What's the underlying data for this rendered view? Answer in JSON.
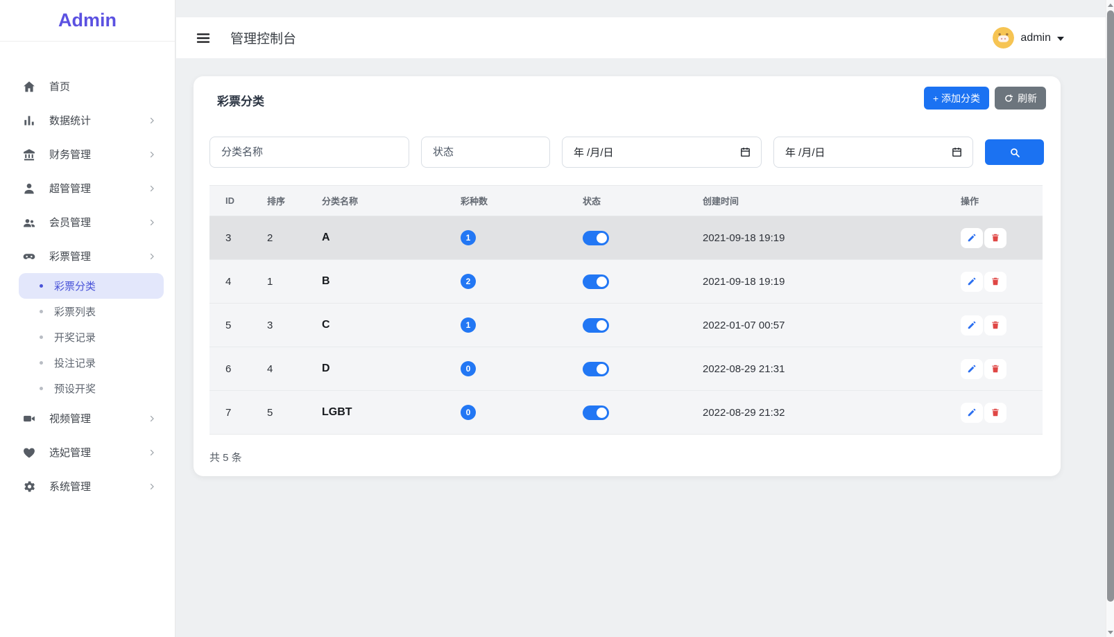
{
  "colors": {
    "accent_blue": "#1b72f2",
    "toggle_blue": "#2277f4",
    "badge_blue": "#2277f4",
    "refresh_gray": "#6c757d",
    "logo_purple": "#5b51e1",
    "active_item_blue": "#4953d8",
    "danger_red": "#df4745",
    "avatar_yellow": "#f6c453"
  },
  "sidebar": {
    "logo": "Admin",
    "items": [
      {
        "label": "首页",
        "icon": "home-icon",
        "expandable": false
      },
      {
        "label": "数据统计",
        "icon": "bar-chart-icon",
        "expandable": true
      },
      {
        "label": "财务管理",
        "icon": "bank-icon",
        "expandable": true
      },
      {
        "label": "超管管理",
        "icon": "user-icon",
        "expandable": true
      },
      {
        "label": "会员管理",
        "icon": "users-icon",
        "expandable": true
      },
      {
        "label": "彩票管理",
        "icon": "gamepad-icon",
        "expandable": true,
        "children": [
          {
            "label": "彩票分类",
            "active": true
          },
          {
            "label": "彩票列表",
            "active": false
          },
          {
            "label": "开奖记录",
            "active": false
          },
          {
            "label": "投注记录",
            "active": false
          },
          {
            "label": "预设开奖",
            "active": false
          }
        ]
      },
      {
        "label": "视频管理",
        "icon": "video-icon",
        "expandable": true
      },
      {
        "label": "选妃管理",
        "icon": "heart-icon",
        "expandable": true
      },
      {
        "label": "系统管理",
        "icon": "gear-icon",
        "expandable": true
      }
    ]
  },
  "topbar": {
    "title": "管理控制台",
    "username": "admin",
    "avatar": "pig-avatar-icon"
  },
  "card": {
    "title": "彩票分类",
    "add_button_label": "+ 添加分类",
    "refresh_button_label": "刷新",
    "filters": {
      "name_placeholder": "分类名称",
      "status_placeholder": "状态",
      "date_placeholder": "年 /月/日"
    },
    "table": {
      "headers": [
        "ID",
        "排序",
        "分类名称",
        "彩种数",
        "状态",
        "创建时间",
        "操作"
      ],
      "rows": [
        {
          "id": "3",
          "sort": "2",
          "name": "A",
          "lottery_count": "1",
          "status_on": true,
          "created_at": "2021-09-18 19:19",
          "highlighted": true
        },
        {
          "id": "4",
          "sort": "1",
          "name": "B",
          "lottery_count": "2",
          "status_on": true,
          "created_at": "2021-09-18 19:19",
          "highlighted": false
        },
        {
          "id": "5",
          "sort": "3",
          "name": "C",
          "lottery_count": "1",
          "status_on": true,
          "created_at": "2022-01-07 00:57",
          "highlighted": false
        },
        {
          "id": "6",
          "sort": "4",
          "name": "D",
          "lottery_count": "0",
          "status_on": true,
          "created_at": "2022-08-29 21:31",
          "highlighted": false
        },
        {
          "id": "7",
          "sort": "5",
          "name": "LGBT",
          "lottery_count": "0",
          "status_on": true,
          "created_at": "2022-08-29 21:32",
          "highlighted": false
        }
      ]
    },
    "footer_total": "共 5 条"
  }
}
